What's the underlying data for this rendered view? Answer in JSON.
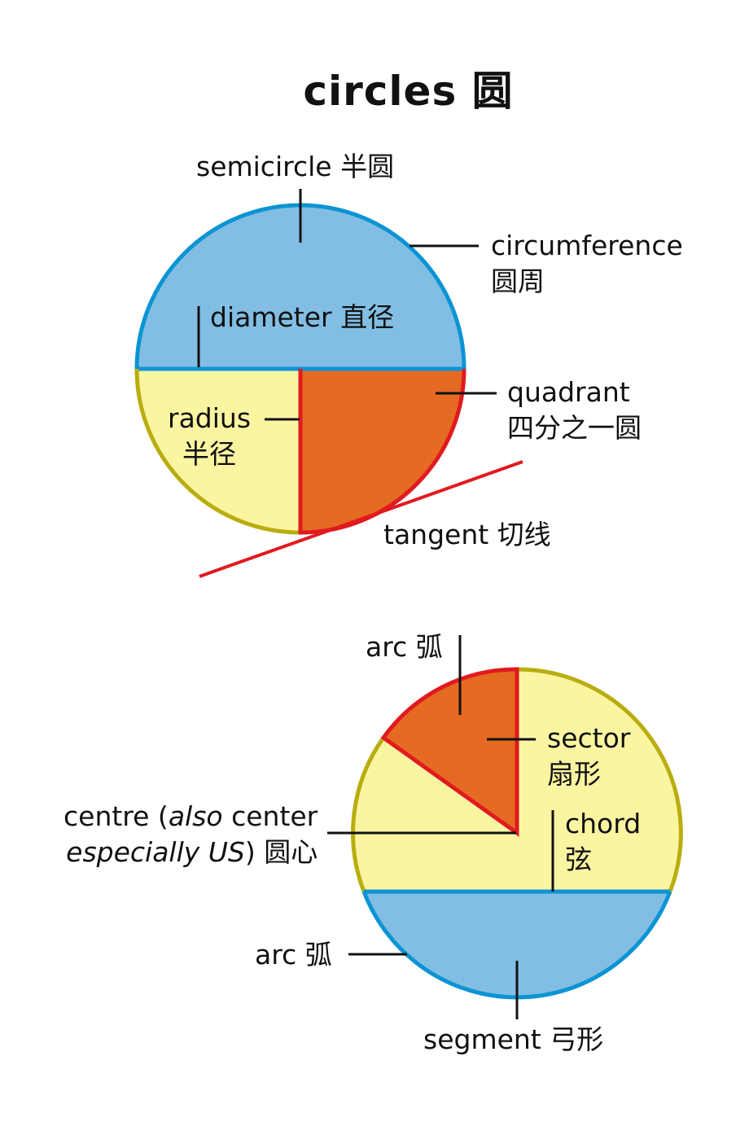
{
  "title": "circles 圆",
  "colors": {
    "blue_fill": "#82bee3",
    "blue_stroke": "#0b94d4",
    "yellow_fill": "#fbf5a2",
    "yellow_stroke": "#b9ad0f",
    "orange_fill": "#e56a22",
    "red_stroke": "#e11a20",
    "leader": "#111111"
  },
  "diagram1": {
    "semicircle": "semicircle 半圆",
    "circumference_en": "circumference",
    "circumference_zh": "圆周",
    "diameter": "diameter 直径",
    "radius_en": "radius",
    "radius_zh": "半径",
    "quadrant_en": "quadrant",
    "quadrant_zh": "四分之一圆",
    "tangent": "tangent 切线"
  },
  "diagram2": {
    "arc_top": "arc 弧",
    "sector_en": "sector",
    "sector_zh": "扇形",
    "centre_line1_a": "centre (",
    "centre_line1_italic": "also",
    "centre_line1_b": " center",
    "centre_line2_italic": "especially US",
    "centre_line2_b": ") 圆心",
    "chord_en": "chord",
    "chord_zh": "弦",
    "arc_bottom": "arc 弧",
    "segment": "segment 弓形"
  }
}
